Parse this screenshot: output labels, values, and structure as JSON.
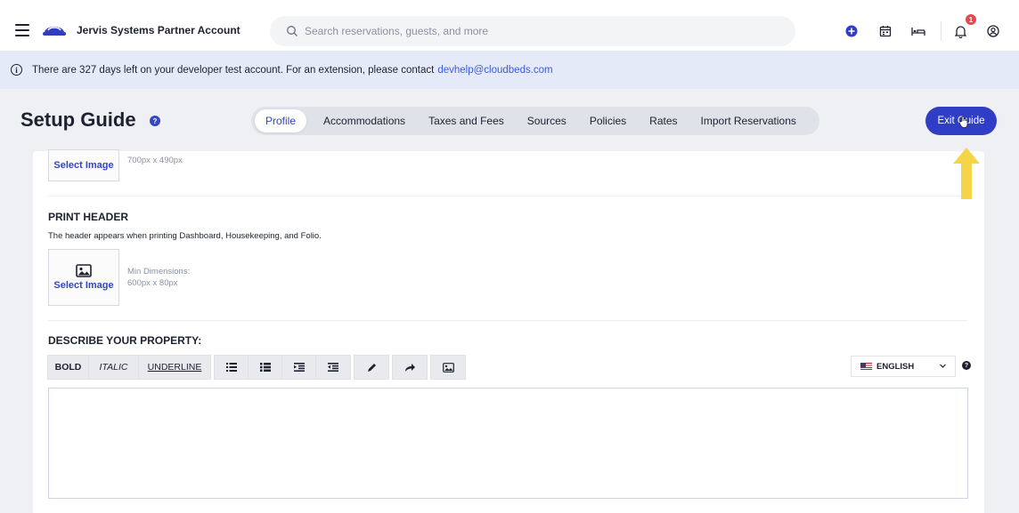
{
  "topbar": {
    "account_name": "Jervis Systems Partner Account",
    "search_placeholder": "Search reservations, guests, and more",
    "notification_count": "1"
  },
  "banner": {
    "info_glyph": "i",
    "text": "There are 327 days left on your developer test account. For an extension, please contact",
    "link": "devhelp@cloudbeds.com"
  },
  "header": {
    "title": "Setup Guide",
    "help_glyph": "?",
    "tabs": [
      {
        "label": "Profile",
        "active": true
      },
      {
        "label": "Accommodations"
      },
      {
        "label": "Taxes and Fees"
      },
      {
        "label": "Sources"
      },
      {
        "label": "Policies"
      },
      {
        "label": "Rates"
      },
      {
        "label": "Import Reservations"
      }
    ],
    "exit_label": "Exit Guide"
  },
  "logo_section": {
    "select_label": "Select Image",
    "dims": "700px x 490px"
  },
  "print_header": {
    "title": "PRINT HEADER",
    "description": "The header appears when printing Dashboard, Housekeeping, and Folio.",
    "select_label": "Select Image",
    "dims_label": "Min Dimensions:",
    "dims": "600px x 80px"
  },
  "describe": {
    "title": "DESCRIBE YOUR PROPERTY:",
    "bold": "BOLD",
    "italic": "ITALIC",
    "underline": "UNDERLINE",
    "language": "ENGLISH",
    "help_glyph": "?"
  },
  "colors": {
    "accent": "#2f3ec5",
    "banner_bg": "#e5eaf9",
    "arrow": "#f5d547",
    "badge": "#e5484d"
  }
}
